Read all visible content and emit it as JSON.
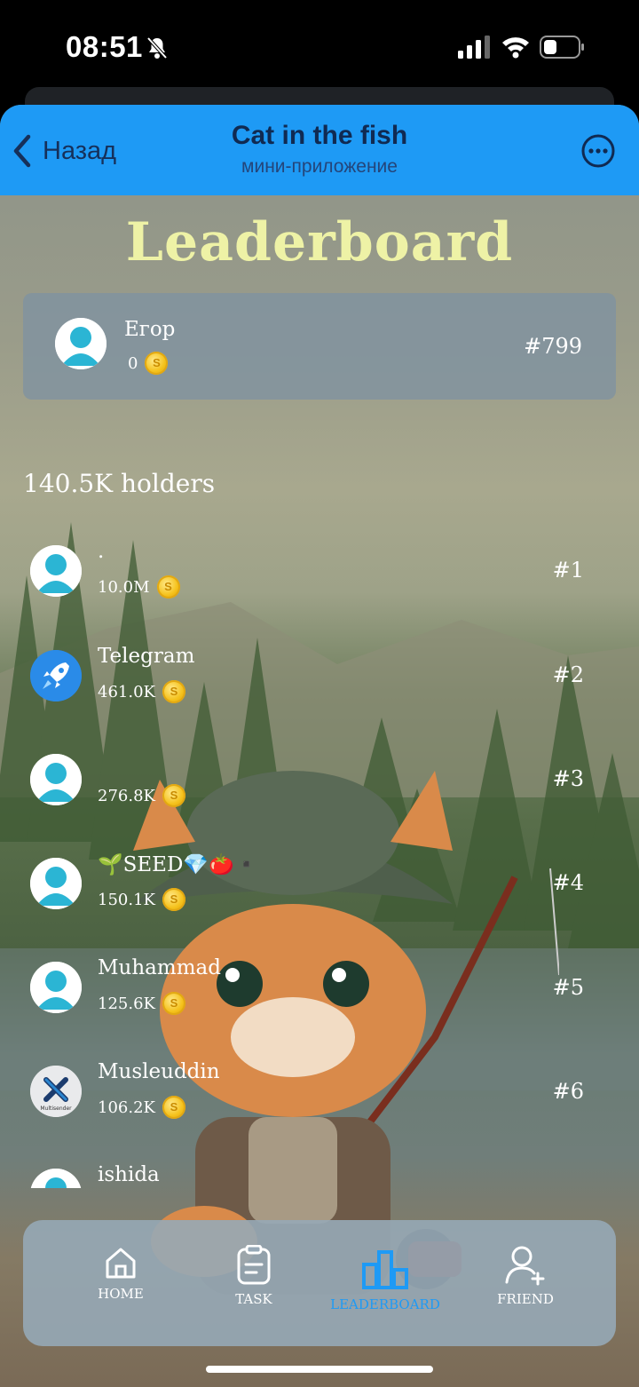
{
  "status_bar": {
    "time": "08:51"
  },
  "header": {
    "back_label": "Назад",
    "title": "Cat in the fish",
    "subtitle": "мини-приложение"
  },
  "page_title": "Leaderboard",
  "me": {
    "name": "Егор",
    "score": "0",
    "rank": "#799"
  },
  "holders_label": "140.5K holders",
  "leaders": [
    {
      "name": ".",
      "score": "10.0M",
      "rank": "#1",
      "avatar": "default-avatar"
    },
    {
      "name": "Telegram",
      "score": "461.0K",
      "rank": "#2",
      "avatar": "rocket-avatar"
    },
    {
      "name": "",
      "score": "276.8K",
      "rank": "#3",
      "avatar": "default-avatar"
    },
    {
      "name": "🌱SEED💎🍅▪️",
      "score": "150.1K",
      "rank": "#4",
      "avatar": "default-avatar"
    },
    {
      "name": "Muhammad",
      "score": "125.6K",
      "rank": "#5",
      "avatar": "default-avatar"
    },
    {
      "name": "Musleuddin",
      "score": "106.2K",
      "rank": "#6",
      "avatar": "multisender-avatar"
    },
    {
      "name": "ishida",
      "score": "",
      "rank": "",
      "avatar": "default-avatar"
    }
  ],
  "multisender_logo_text": "Multisender",
  "tabs": [
    {
      "label": "HOME",
      "icon": "home-icon"
    },
    {
      "label": "TASK",
      "icon": "clipboard-icon"
    },
    {
      "label": "LEADERBOARD",
      "icon": "leaderboard-icon",
      "active": true
    },
    {
      "label": "FRIEND",
      "icon": "add-friend-icon"
    }
  ],
  "colors": {
    "accent": "#1e9af5",
    "title": "#eef2a6",
    "avatar": "#2bb5d4"
  }
}
